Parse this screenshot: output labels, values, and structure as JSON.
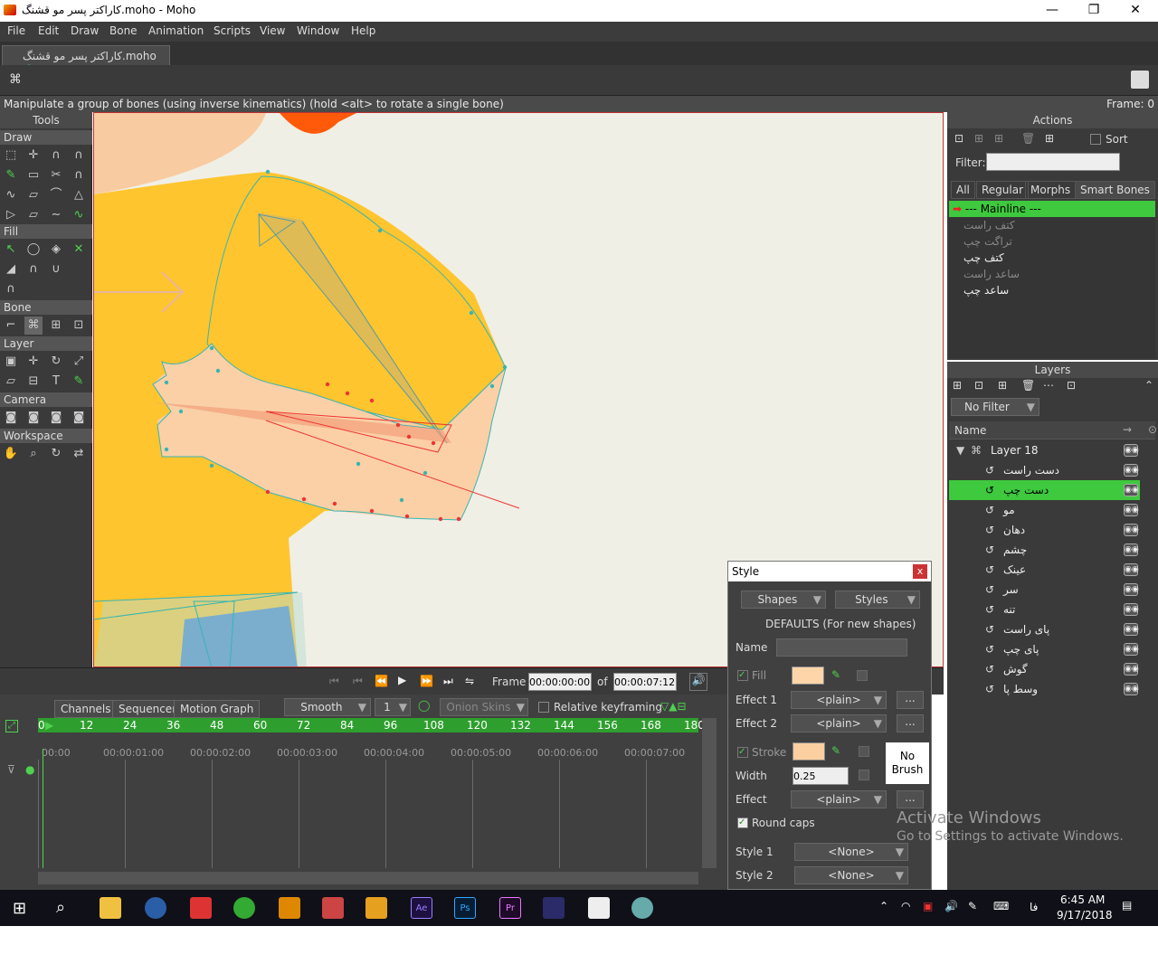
{
  "window": {
    "title": "کاراکتر پسر مو قشنگ.moho - Moho",
    "minimize": "—",
    "maximize": "❐",
    "close": "✕"
  },
  "menu": [
    "File",
    "Edit",
    "Draw",
    "Bone",
    "Animation",
    "Scripts",
    "View",
    "Window",
    "Help"
  ],
  "doc_tab": "کاراکتر پسر مو قشنگ.moho",
  "status": {
    "hint": "Manipulate a group of bones (using inverse kinematics) (hold <alt> to rotate a single bone)",
    "frame": "Frame: 0"
  },
  "tools": {
    "title": "Tools",
    "sections": {
      "draw": "Draw",
      "fill": "Fill",
      "bone": "Bone",
      "layer": "Layer",
      "camera": "Camera",
      "workspace": "Workspace"
    }
  },
  "actions": {
    "title": "Actions",
    "sort": "Sort",
    "filter_label": "Filter:",
    "tabs": [
      "All",
      "Regular",
      "Morphs",
      "Smart Bones"
    ],
    "items": [
      {
        "label": "--- Mainline ---",
        "state": "selected"
      },
      {
        "label": "کتف راست",
        "state": "dim"
      },
      {
        "label": "تراگت چپ",
        "state": "dim"
      },
      {
        "label": "کتف چپ",
        "state": "normal"
      },
      {
        "label": "ساعد راست",
        "state": "dim"
      },
      {
        "label": "ساعد چپ",
        "state": "normal"
      }
    ]
  },
  "layers": {
    "title": "Layers",
    "filter": "No Filter",
    "name_header": "Name",
    "group": "Layer 18",
    "items": [
      "دست راست",
      "دست چپ",
      "مو",
      "دهان",
      "چشم",
      "عینک",
      "سر",
      "تنه",
      "پای راست",
      "پای چپ",
      "گوش",
      "وسط پا"
    ],
    "selected_index": 1
  },
  "playback": {
    "frame_label": "Frame",
    "frame_value": "00:00:00:00",
    "of_label": "of",
    "total": "00:00:07:12"
  },
  "timeline": {
    "tabs": [
      "Channels",
      "Sequencer",
      "Motion Graph"
    ],
    "interp": "Smooth",
    "interp_num": "1",
    "onion": "Onion Skins",
    "relative": "Relative keyframing",
    "ruler": [
      "0",
      "12",
      "24",
      "36",
      "48",
      "60",
      "72",
      "84",
      "96",
      "108",
      "120",
      "132",
      "144",
      "156",
      "168",
      "180"
    ],
    "times": [
      "00:00",
      "00:00:01:00",
      "00:00:02:00",
      "00:00:03:00",
      "00:00:04:00",
      "00:00:05:00",
      "00:00:06:00",
      "00:00:07:00"
    ]
  },
  "style": {
    "title": "Style",
    "close": "x",
    "shapes": "Shapes",
    "styles": "Styles",
    "defaults": "DEFAULTS (For new shapes)",
    "name_label": "Name",
    "fill_label": "Fill",
    "fill_color": "#fdd5a8",
    "effect1_label": "Effect 1",
    "effect2_label": "Effect 2",
    "plain": "<plain>",
    "stroke_label": "Stroke",
    "stroke_color": "#fbcfa0",
    "width_label": "Width",
    "width_value": "0.25",
    "effect_label": "Effect",
    "no_brush": "No Brush",
    "round_caps": "Round caps",
    "style1_label": "Style 1",
    "style2_label": "Style 2",
    "none": "<None>",
    "ellipsis": "..."
  },
  "watermark": {
    "line1": "Activate Windows",
    "line2": "Go to Settings to activate Windows."
  },
  "taskbar": {
    "time": "6:45 AM",
    "date": "9/17/2018",
    "lang": "فا",
    "apps": [
      "Ae",
      "Ps",
      "Pr"
    ]
  }
}
